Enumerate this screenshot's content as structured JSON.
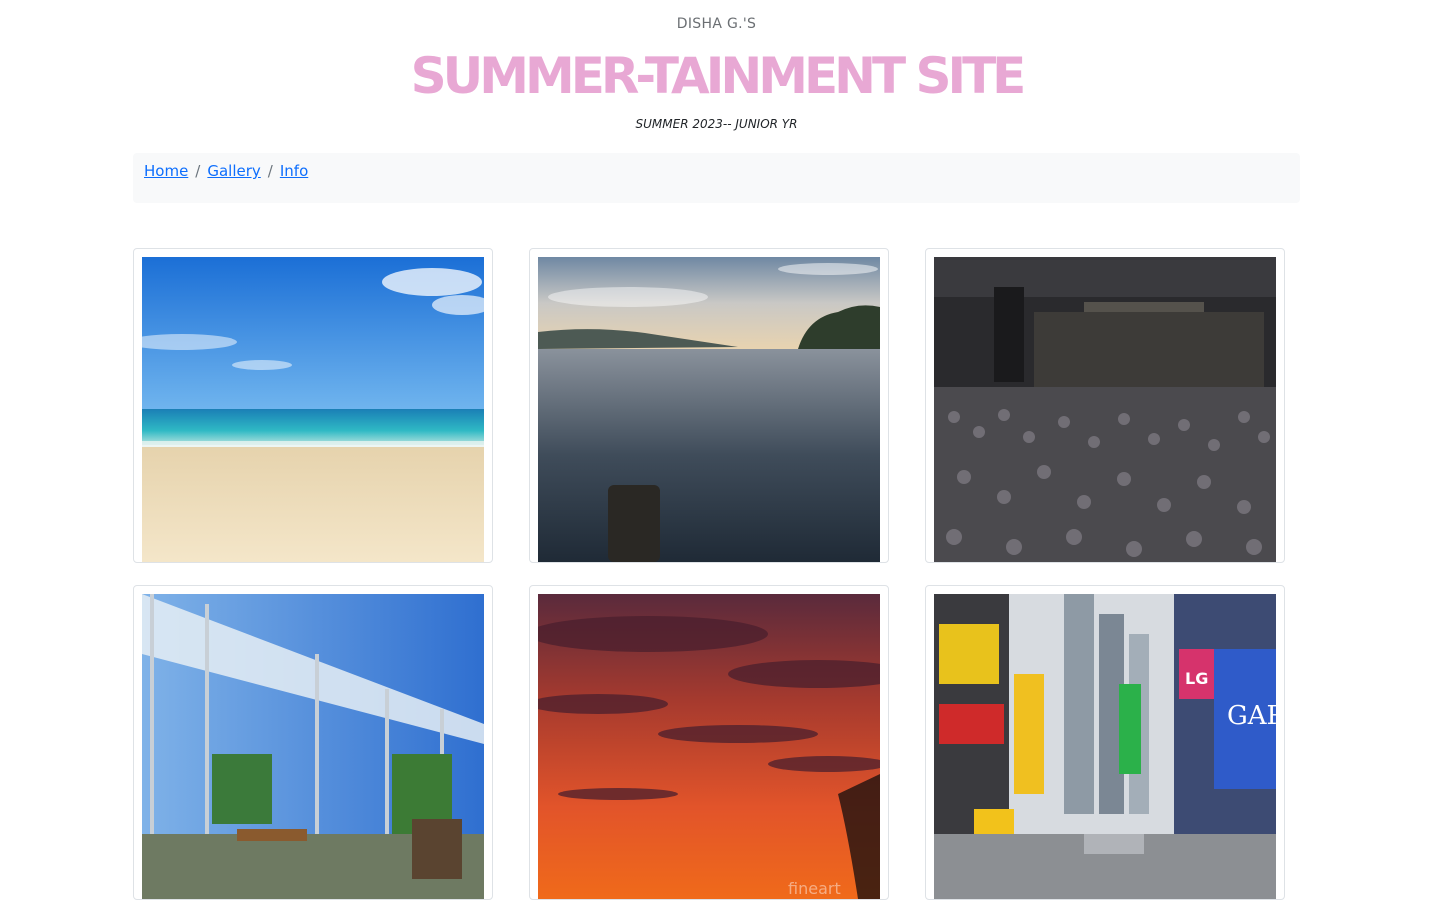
{
  "header": {
    "owner": "DISHA G.'S",
    "title": "SUMMER-TAINMENT SITE",
    "subtitle": "SUMMER 2023-- JUNIOR YR",
    "title_color": "#e8a8d4"
  },
  "breadcrumb": {
    "items": [
      {
        "label": "Home"
      },
      {
        "label": "Gallery"
      },
      {
        "label": "Info"
      }
    ],
    "separator": "/",
    "link_color": "#0d6efd"
  },
  "gallery": {
    "images": [
      {
        "subject": "beach"
      },
      {
        "subject": "lake-at-sunset"
      },
      {
        "subject": "concert-crowd"
      },
      {
        "subject": "greenhouse"
      },
      {
        "subject": "red-sunset-sky",
        "watermark": "fineart"
      },
      {
        "subject": "times-square",
        "signs": [
          "LG",
          "GAP"
        ]
      }
    ]
  }
}
